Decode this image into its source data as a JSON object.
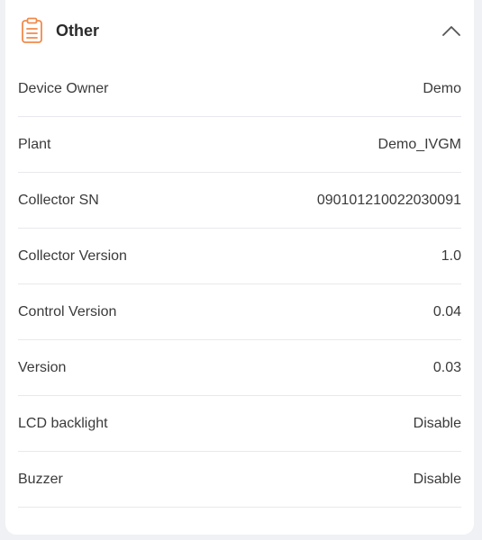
{
  "section": {
    "title": "Other",
    "icon": "clipboard-icon",
    "toggle_icon": "chevron-up-icon",
    "accent_color": "#f08a4b"
  },
  "rows": [
    {
      "label": "Device Owner",
      "value": "Demo"
    },
    {
      "label": "Plant",
      "value": "Demo_IVGM"
    },
    {
      "label": "Collector SN",
      "value": "090101210022030091"
    },
    {
      "label": "Collector Version",
      "value": "1.0"
    },
    {
      "label": "Control Version",
      "value": "0.04"
    },
    {
      "label": "Version",
      "value": "0.03"
    },
    {
      "label": "LCD backlight",
      "value": "Disable"
    },
    {
      "label": "Buzzer",
      "value": "Disable"
    }
  ]
}
